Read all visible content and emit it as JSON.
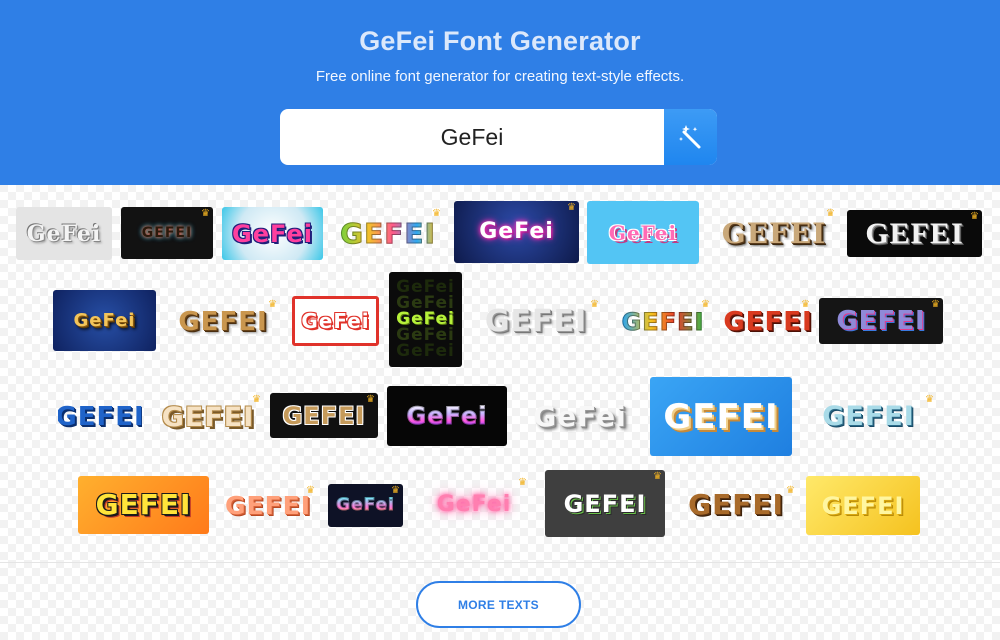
{
  "header": {
    "title": "GeFei Font Generator",
    "subtitle": "Free online font generator for creating text-style effects."
  },
  "search": {
    "value": "GeFei",
    "button_icon": "magic-wand-icon"
  },
  "styles": [
    {
      "text": "GeFei",
      "premium": false
    },
    {
      "text": "GEFEI",
      "premium": true
    },
    {
      "text": "GeFei",
      "premium": false
    },
    {
      "text": "GEFEI",
      "premium": true
    },
    {
      "text": "GeFei",
      "premium": true
    },
    {
      "text": "GeFei",
      "premium": false
    },
    {
      "text": "GEFEI",
      "premium": true
    },
    {
      "text": "GEFEI",
      "premium": true
    },
    {
      "text": "GeFei",
      "premium": false
    },
    {
      "text": "GEFEI",
      "premium": true
    },
    {
      "text": "GeFei",
      "premium": false
    },
    {
      "text": "GeFei",
      "premium": false
    },
    {
      "text": "GEFEI",
      "premium": true
    },
    {
      "text": "GEFEI",
      "premium": true
    },
    {
      "text": "GEFEI",
      "premium": true
    },
    {
      "text": "GEFEI",
      "premium": true
    },
    {
      "text": "GEFEI",
      "premium": false
    },
    {
      "text": "GEFEI",
      "premium": true
    },
    {
      "text": "GEFEI",
      "premium": true
    },
    {
      "text": "GeFei",
      "premium": false
    },
    {
      "text": "GeFei",
      "premium": false
    },
    {
      "text": "GEFEI",
      "premium": false
    },
    {
      "text": "GEFEI",
      "premium": true
    },
    {
      "text": "GEFEI",
      "premium": false
    },
    {
      "text": "GEFEI",
      "premium": true
    },
    {
      "text": "GeFei",
      "premium": true
    },
    {
      "text": "GeFei",
      "premium": true
    },
    {
      "text": "GEFEI",
      "premium": true
    },
    {
      "text": "GEFEI",
      "premium": true
    },
    {
      "text": "GEFEI",
      "premium": false
    }
  ],
  "more_button": "MORE TEXTS"
}
